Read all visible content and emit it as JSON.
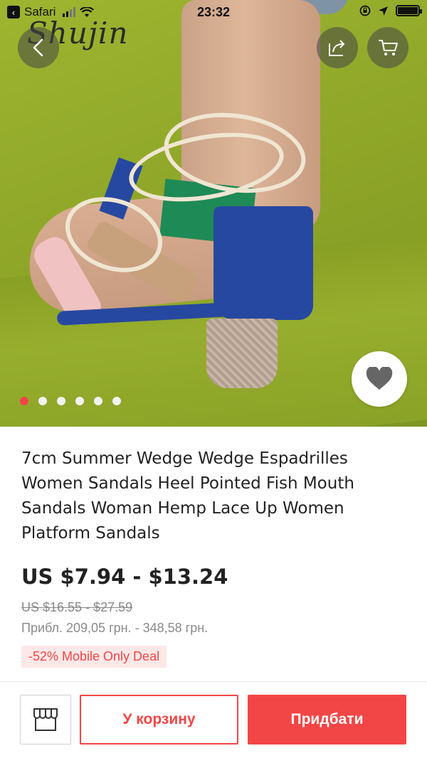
{
  "status_bar": {
    "back_app": "Safari",
    "time": "23:32"
  },
  "brand": {
    "logo_text": "Shujin"
  },
  "gallery": {
    "image_count": 6,
    "active_index": 0
  },
  "product": {
    "title": "7cm Summer Wedge Wedge Espadrilles Women Sandals Heel Pointed Fish Mouth Sandals Woman Hemp Lace Up Women Platform Sandals",
    "price": "US $7.94 - $13.24",
    "old_price": "US $16.55 - $27.59",
    "approx_price": "Прибл. 209,05 грн. - 348,58 грн.",
    "deal_badge": "-52% Mobile Only Deal"
  },
  "actions": {
    "add_to_cart": "У корзину",
    "buy_now": "Придбати"
  },
  "colors": {
    "accent": "#f24646",
    "deal_bg": "#fde8e8"
  },
  "icons": [
    "chevron-left-icon",
    "share-icon",
    "cart-icon",
    "heart-icon",
    "store-icon",
    "wifi-icon",
    "location-icon",
    "lock-rotation-icon",
    "battery-icon"
  ]
}
